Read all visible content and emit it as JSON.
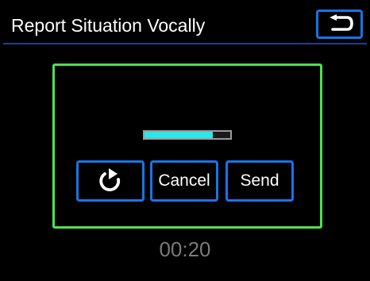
{
  "header": {
    "title": "Report Situation Vocally",
    "back_icon": "return-arrow-icon"
  },
  "recording": {
    "progress_fraction": 0.8,
    "timer": "00:20"
  },
  "actions": {
    "replay_icon": "replay-arrow-icon",
    "cancel_label": "Cancel",
    "send_label": "Send"
  },
  "colors": {
    "background": "#000000",
    "button_border": "#1a73e8",
    "panel_border": "#4ee04e",
    "progress_fill": "#2ee6e6",
    "timer_text": "#7a7a7a"
  }
}
